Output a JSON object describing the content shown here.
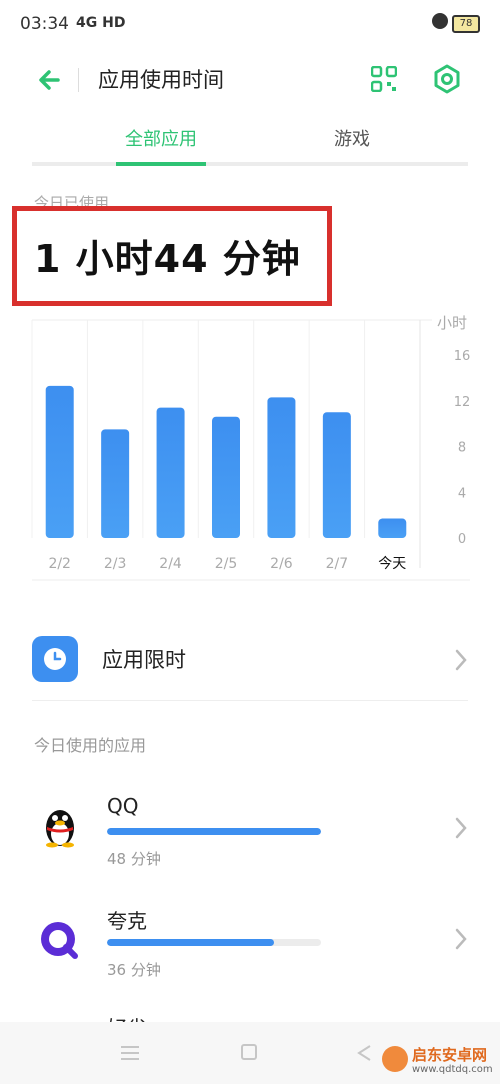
{
  "status_bar": {
    "time": "03:34",
    "network": "4G HD",
    "battery": "78"
  },
  "header": {
    "title": "应用使用时间"
  },
  "tabs": [
    {
      "label": "全部应用"
    },
    {
      "label": "游戏"
    }
  ],
  "summary": {
    "label": "今日已使用",
    "total": "1 小时44 分钟"
  },
  "chart_data": {
    "type": "bar",
    "unit_label": "小时",
    "categories": [
      "2/2",
      "2/3",
      "2/4",
      "2/5",
      "2/6",
      "2/7",
      "今天"
    ],
    "values": [
      13.3,
      9.5,
      11.4,
      10.6,
      12.3,
      11.0,
      1.7
    ],
    "ylim": [
      0,
      16
    ],
    "yticks": [
      16,
      12,
      8,
      4,
      0
    ],
    "highlight_category": "今天",
    "colors": {
      "bar": "#3d8ff0",
      "bar_top": "#4aa0f5"
    }
  },
  "limit": {
    "label": "应用限时"
  },
  "apps_section": {
    "label": "今日使用的应用"
  },
  "apps": [
    {
      "name": "QQ",
      "usage": "48 分钟",
      "share": 1.0,
      "icon": "qq-penguin-icon"
    },
    {
      "name": "夸克",
      "usage": "36 分钟",
      "share": 0.78,
      "icon": "quark-icon"
    },
    {
      "name": "好省",
      "usage": "",
      "share": 0.0,
      "icon": "app-icon"
    }
  ],
  "watermark": {
    "name": "启东安卓网",
    "url": "www.qdtdq.com"
  },
  "colors": {
    "accent": "#2ec374",
    "highlight_box": "#d8302d",
    "blue": "#3d8ff0"
  }
}
